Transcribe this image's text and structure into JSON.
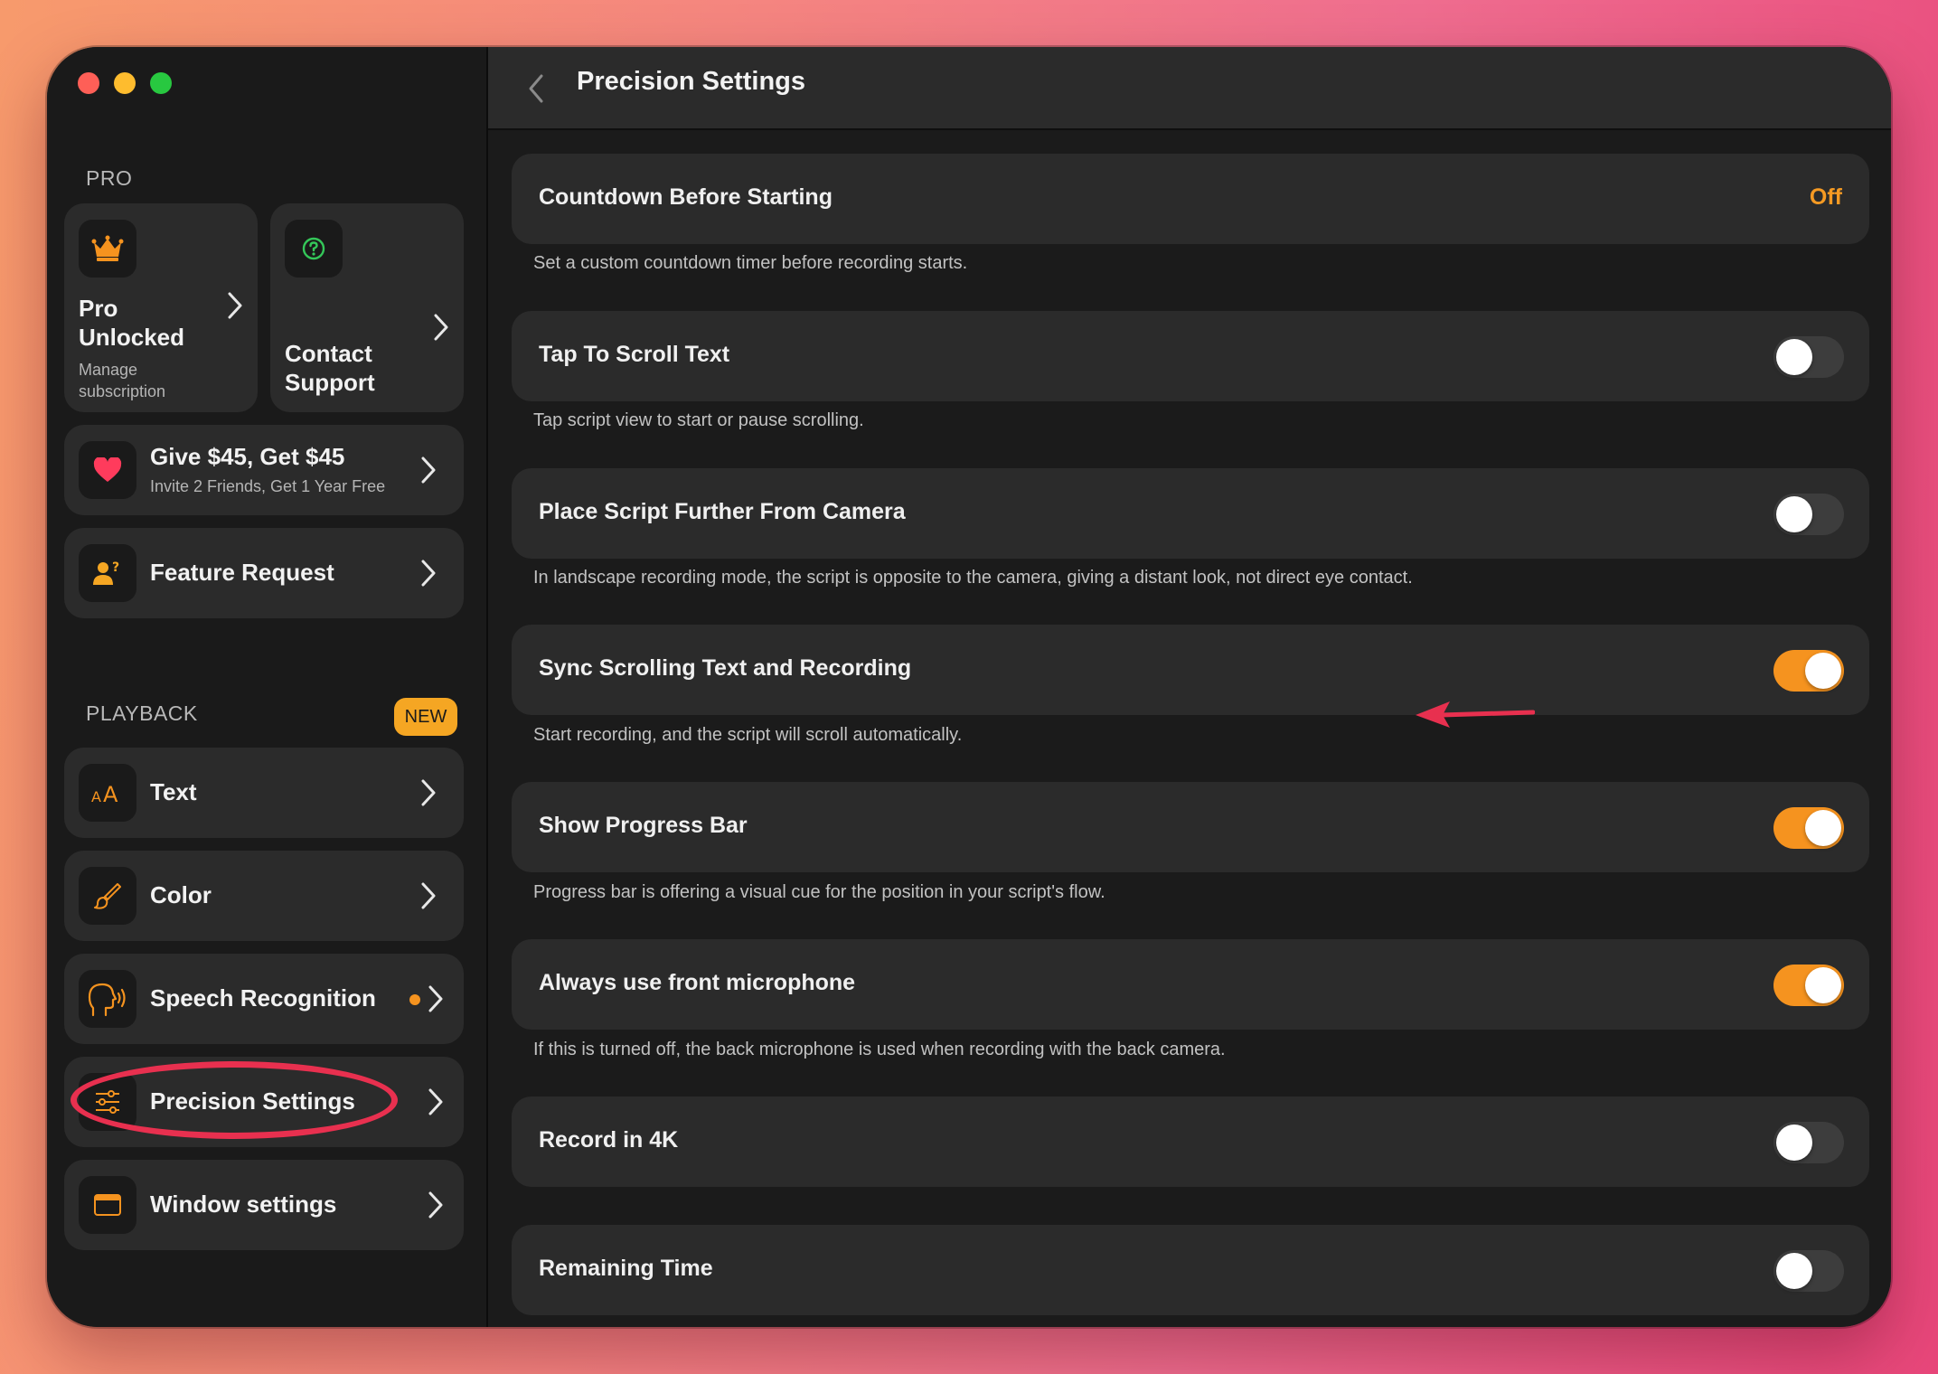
{
  "sidebar": {
    "pro_section": "PRO",
    "pro_card": {
      "title_line1": "Pro",
      "title_line2": "Unlocked",
      "sub_line1": "Manage",
      "sub_line2": "subscription"
    },
    "support_card": {
      "title_line1": "Contact",
      "title_line2": "Support"
    },
    "referral": {
      "title": "Give $45, Get $45",
      "subtitle": "Invite 2 Friends, Get 1 Year Free"
    },
    "feature_request": "Feature Request",
    "playback_section": "PLAYBACK",
    "new_badge": "NEW",
    "items": [
      {
        "label": "Text",
        "icon": "text-size-icon"
      },
      {
        "label": "Color",
        "icon": "brush-icon"
      },
      {
        "label": "Speech Recognition",
        "icon": "speech-head-icon"
      },
      {
        "label": "Precision Settings",
        "icon": "sliders-icon"
      },
      {
        "label": "Window settings",
        "icon": "window-icon"
      }
    ]
  },
  "header": {
    "title": "Precision Settings"
  },
  "settings": [
    {
      "label": "Countdown Before Starting",
      "value": "Off",
      "description": "Set a custom countdown timer before recording starts."
    },
    {
      "label": "Tap To Scroll Text",
      "toggle": false,
      "description": "Tap script view to start or pause scrolling."
    },
    {
      "label": "Place Script Further From Camera",
      "toggle": false,
      "description": "In landscape recording mode, the script is opposite to the camera, giving a distant look, not direct eye contact."
    },
    {
      "label": "Sync Scrolling Text and Recording",
      "toggle": true,
      "description": "Start recording, and the script will scroll automatically."
    },
    {
      "label": "Show Progress Bar",
      "toggle": true,
      "description": "Progress bar is offering a visual cue for the position in your script's flow."
    },
    {
      "label": "Always use front microphone",
      "toggle": true,
      "description": "If this is turned off, the back microphone is used when recording with the back camera."
    },
    {
      "label": "Record in 4K",
      "toggle": false
    },
    {
      "label": "Remaining Time",
      "toggle": false
    }
  ],
  "colors": {
    "accent": "#f5931f",
    "annotation": "#e8304f",
    "background": "#1b1b1b",
    "card": "#2b2b2b"
  }
}
